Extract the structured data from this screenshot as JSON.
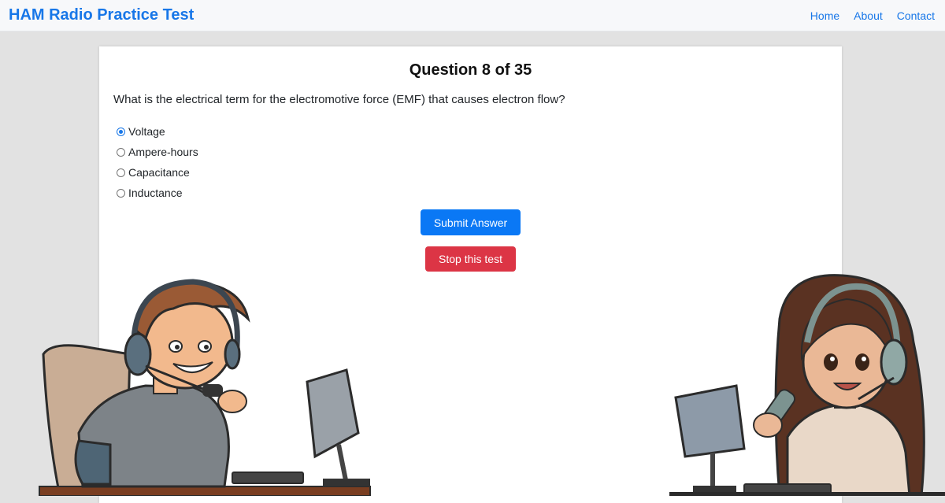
{
  "navbar": {
    "brand": "HAM Radio Practice Test",
    "links": [
      "Home",
      "About",
      "Contact"
    ]
  },
  "quiz": {
    "title": "Question 8 of 35",
    "question": "What is the electrical term for the electromotive force (EMF) that causes electron flow?",
    "options": [
      {
        "label": "Voltage",
        "selected": true
      },
      {
        "label": "Ampere-hours",
        "selected": false
      },
      {
        "label": "Capacitance",
        "selected": false
      },
      {
        "label": "Inductance",
        "selected": false
      }
    ],
    "submit_label": "Submit Answer",
    "stop_label": "Stop this test"
  },
  "colors": {
    "brand": "#1877e8",
    "primary_button": "#0a78f5",
    "danger_button": "#dc3545",
    "page_background": "#e2e2e2"
  },
  "illustrations": [
    "man-ham-operator-illustration",
    "woman-ham-operator-illustration"
  ]
}
